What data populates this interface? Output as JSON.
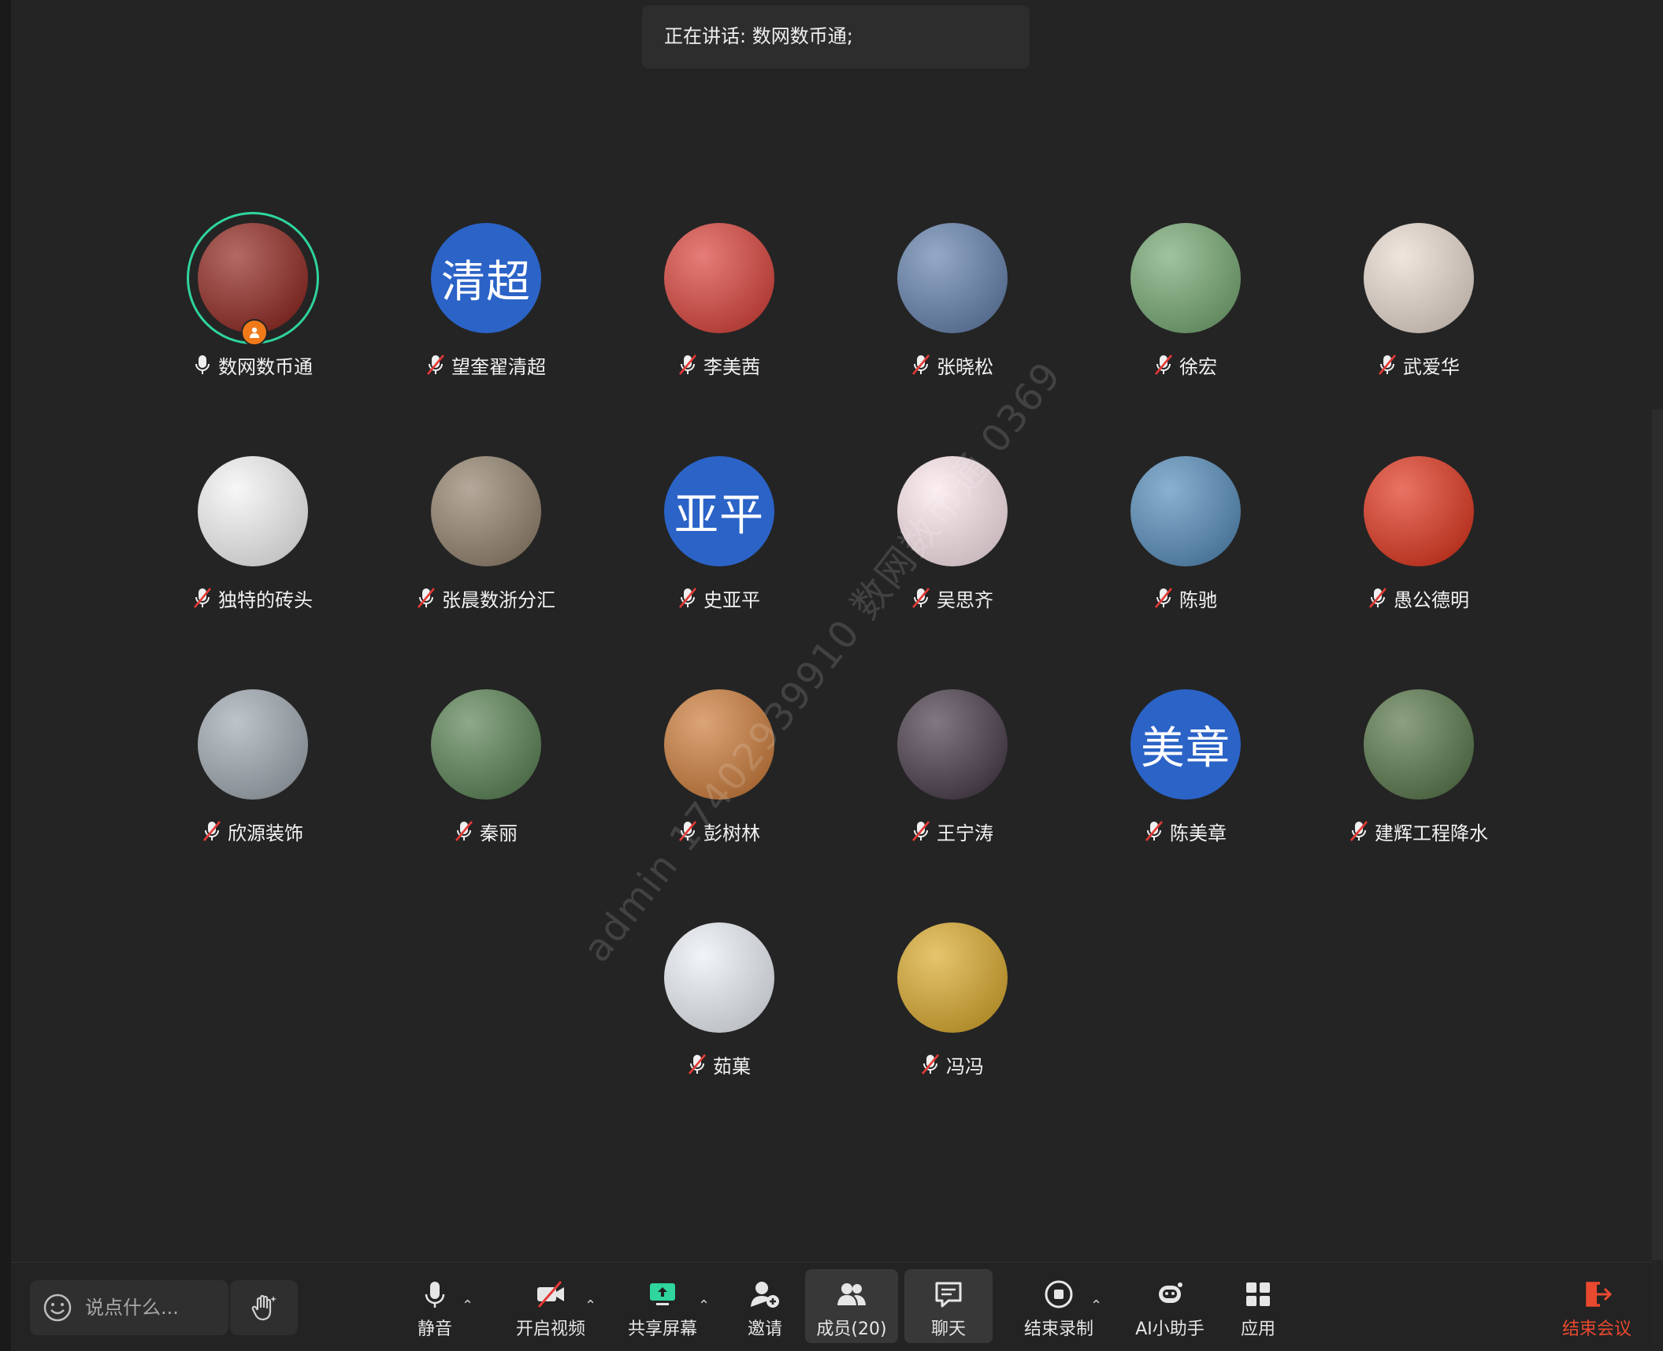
{
  "speaking": {
    "label": "正在讲话: 数网数币通;"
  },
  "participants": [
    {
      "name": "数网数币通",
      "avatar_text": "",
      "avatar_color": "#8a1a12",
      "mic": "on",
      "speaking": true,
      "host": true
    },
    {
      "name": "望奎翟清超",
      "avatar_text": "清超",
      "avatar_color": "#2b63c7",
      "mic": "off"
    },
    {
      "name": "李美茜",
      "avatar_text": "",
      "avatar_color": "#d8372f",
      "mic": "off"
    },
    {
      "name": "张晓松",
      "avatar_text": "",
      "avatar_color": "#5b7aa8",
      "mic": "off"
    },
    {
      "name": "徐宏",
      "avatar_text": "",
      "avatar_color": "#6da36a",
      "mic": "off"
    },
    {
      "name": "武爱华",
      "avatar_text": "",
      "avatar_color": "#e7d8cc",
      "mic": "off"
    },
    {
      "name": "独特的砖头",
      "avatar_text": "",
      "avatar_color": "#f3f3f3",
      "mic": "off"
    },
    {
      "name": "张晨数浙分汇",
      "avatar_text": "",
      "avatar_color": "#8c7a64",
      "mic": "off"
    },
    {
      "name": "史亚平",
      "avatar_text": "亚平",
      "avatar_color": "#2b63c7",
      "mic": "off"
    },
    {
      "name": "吴思齐",
      "avatar_text": "",
      "avatar_color": "#fbe4ea",
      "mic": "off"
    },
    {
      "name": "陈驰",
      "avatar_text": "",
      "avatar_color": "#4c86b6",
      "mic": "off"
    },
    {
      "name": "愚公德明",
      "avatar_text": "",
      "avatar_color": "#de2910",
      "mic": "off"
    },
    {
      "name": "欣源装饰",
      "avatar_text": "",
      "avatar_color": "#9aa4ad",
      "mic": "off"
    },
    {
      "name": "秦丽",
      "avatar_text": "",
      "avatar_color": "#4f7a49",
      "mic": "off"
    },
    {
      "name": "彭树林",
      "avatar_text": "",
      "avatar_color": "#c9742e",
      "mic": "off"
    },
    {
      "name": "王宁涛",
      "avatar_text": "",
      "avatar_color": "#3c2f3e",
      "mic": "off"
    },
    {
      "name": "陈美章",
      "avatar_text": "美章",
      "avatar_color": "#2b63c7",
      "mic": "off"
    },
    {
      "name": "建辉工程降水",
      "avatar_text": "",
      "avatar_color": "#4d6e3e",
      "mic": "off"
    },
    {
      "name": "茹菓",
      "avatar_text": "",
      "avatar_color": "#e9eef4",
      "mic": "off"
    },
    {
      "name": "冯冯",
      "avatar_text": "",
      "avatar_color": "#d8a520",
      "mic": "off"
    }
  ],
  "watermark": "admin 17402939910 数网数币通 0369",
  "toolbar": {
    "chat_placeholder": "说点什么...",
    "mute": "静音",
    "video": "开启视频",
    "share": "共享屏幕",
    "invite": "邀请",
    "members": "成员(20)",
    "chat": "聊天",
    "record": "结束录制",
    "ai": "AI小助手",
    "apps": "应用",
    "end": "结束会议"
  },
  "colors": {
    "background": "#242424",
    "accent": "#2fd59c",
    "danger": "#e9492f",
    "mic_off": "#e53935"
  }
}
